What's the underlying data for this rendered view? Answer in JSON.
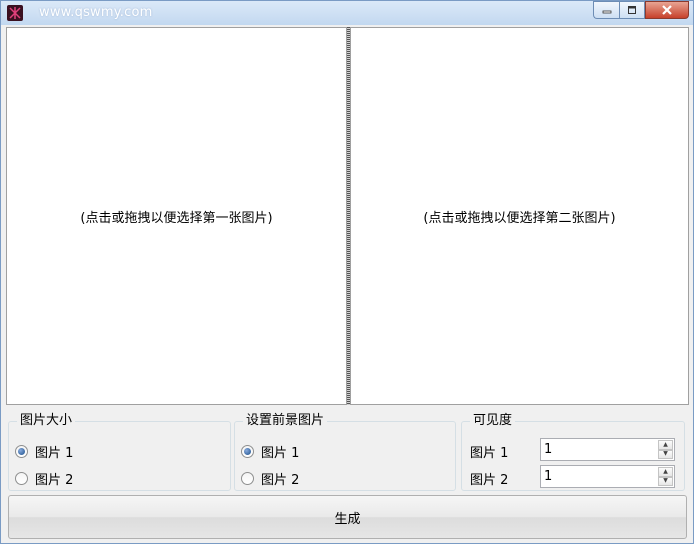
{
  "window": {
    "title": "www.qswmy.com",
    "controls": [
      "minimize",
      "maximize",
      "close"
    ]
  },
  "panes": {
    "left_hint": "(点击或拖拽以便选择第一张图片)",
    "right_hint": "(点击或拖拽以便选择第二张图片)"
  },
  "size_group": {
    "title": "图片大小",
    "options": [
      "图片 1",
      "图片 2"
    ],
    "selected_index": 0
  },
  "foreground_group": {
    "title": "设置前景图片",
    "options": [
      "图片 1",
      "图片 2"
    ],
    "selected_index": 0
  },
  "visibility_group": {
    "title": "可见度",
    "rows": [
      {
        "label": "图片 1",
        "value": "1"
      },
      {
        "label": "图片 2",
        "value": "1"
      }
    ]
  },
  "generate_label": "生成",
  "icons": {
    "app": "app-logo-icon",
    "minimize": "minimize-icon",
    "maximize": "maximize-icon",
    "close": "close-icon",
    "spin_up": "spin-up-icon",
    "spin_down": "spin-down-icon"
  }
}
